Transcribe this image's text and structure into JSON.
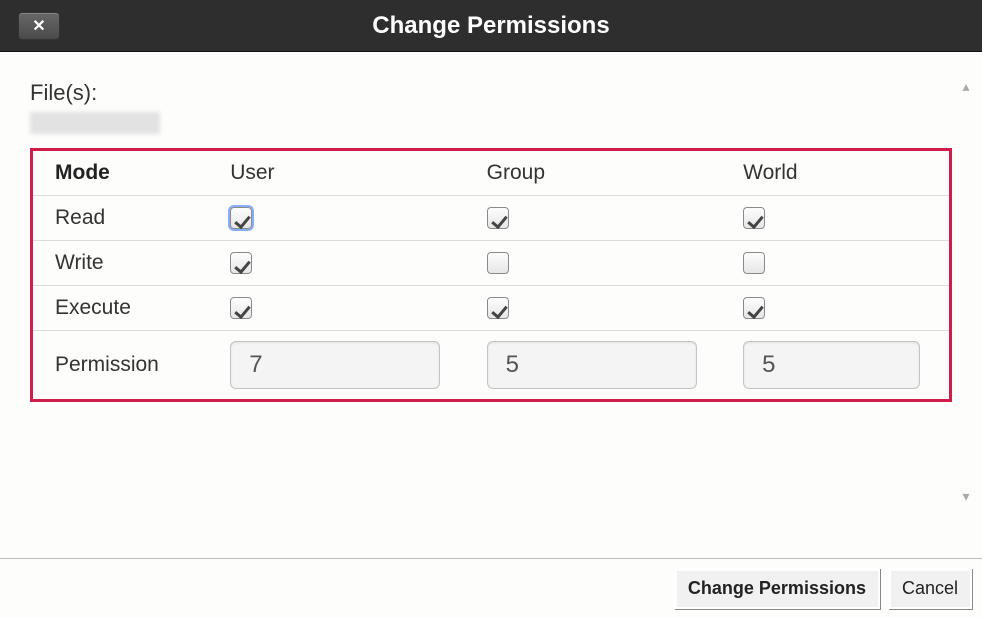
{
  "dialog": {
    "title": "Change Permissions",
    "files_label": "File(s):"
  },
  "table": {
    "headers": {
      "mode": "Mode",
      "user": "User",
      "group": "Group",
      "world": "World"
    },
    "rows": {
      "read": {
        "label": "Read",
        "user": true,
        "group": true,
        "world": true
      },
      "write": {
        "label": "Write",
        "user": true,
        "group": false,
        "world": false
      },
      "execute": {
        "label": "Execute",
        "user": true,
        "group": true,
        "world": true
      }
    },
    "permission_label": "Permission",
    "permission_values": {
      "user": "7",
      "group": "5",
      "world": "5"
    }
  },
  "buttons": {
    "submit": "Change Permissions",
    "cancel": "Cancel"
  }
}
